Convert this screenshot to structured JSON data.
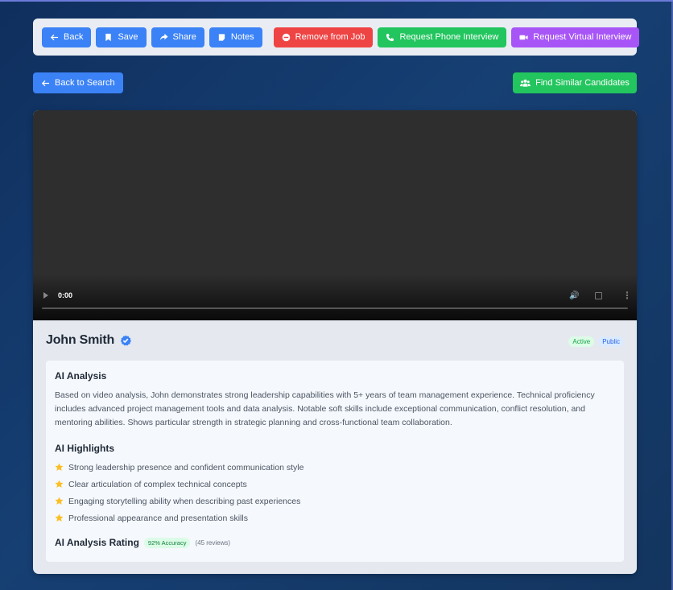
{
  "toolbar": {
    "back": "Back",
    "save": "Save",
    "share": "Share",
    "notes": "Notes",
    "remove": "Remove from Job",
    "phone": "Request Phone Interview",
    "virtual": "Request Virtual Interview"
  },
  "nav": {
    "back_to_search": "Back to Search",
    "find_similar": "Find Similar Candidates"
  },
  "video": {
    "time": "0:00"
  },
  "candidate": {
    "name": "John Smith",
    "status": "Active",
    "visibility": "Public"
  },
  "ai": {
    "analysis_title": "AI Analysis",
    "analysis_text": "Based on video analysis, John demonstrates strong leadership capabilities with 5+ years of team management experience. Technical proficiency includes advanced project management tools and data analysis. Notable soft skills include exceptional communication, conflict resolution, and mentoring abilities. Shows particular strength in strategic planning and cross-functional team collaboration.",
    "highlights_title": "AI Highlights",
    "highlights": [
      "Strong leadership presence and confident communication style",
      "Clear articulation of complex technical concepts",
      "Engaging storytelling ability when describing past experiences",
      "Professional appearance and presentation skills"
    ],
    "rating_title": "AI Analysis Rating",
    "accuracy": "92% Accuracy",
    "reviews": "(45 reviews)"
  },
  "colors": {
    "primary_blue": "#3b82f6",
    "danger_red": "#ef4444",
    "success_green": "#22c55e",
    "purple": "#a855f7",
    "star": "#fbbf24"
  }
}
